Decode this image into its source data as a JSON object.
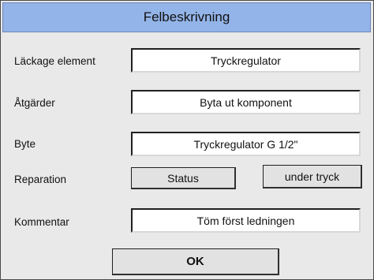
{
  "dialog": {
    "title": "Felbeskrivning"
  },
  "rows": {
    "leakage": {
      "label": "Läckage element",
      "value": "Tryckregulator"
    },
    "actions": {
      "label": "Åtgärder",
      "value": "Byta ut komponent"
    },
    "replace": {
      "label": "Byte",
      "value": "Tryckregulator G 1/2\""
    },
    "repair": {
      "label": "Reparation",
      "status_button": "Status",
      "pressure_button": "under tryck"
    },
    "comment": {
      "label": "Kommentar",
      "value": "Töm först ledningen"
    }
  },
  "ok_button": "OK"
}
